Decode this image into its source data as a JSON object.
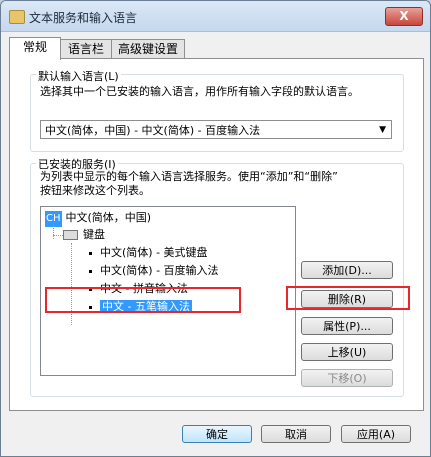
{
  "window": {
    "title": "文本服务和输入语言",
    "close_label": "X"
  },
  "tabs": [
    {
      "label": "常规"
    },
    {
      "label": "语言栏"
    },
    {
      "label": "高级键设置"
    }
  ],
  "default_language": {
    "group_title": "默认输入语言(L)",
    "description": "选择其中一个已安装的输入语言，用作所有输入字段的默认语言。",
    "selected_value": "中文(简体，中国) - 中文(简体) - 百度输入法"
  },
  "installed_services": {
    "group_title": "已安装的服务(I)",
    "description_line1": "为列表中显示的每个输入语言选择服务。使用“添加”和“删除”",
    "description_line2": "按钮来修改这个列表。",
    "tree": {
      "language_badge": "CH",
      "language": "中文(简体，中国)",
      "category": "键盘",
      "items": [
        {
          "label": "中文(简体) - 美式键盘"
        },
        {
          "label": "中文(简体) - 百度输入法"
        },
        {
          "label": "中文 - 拼音输入法"
        },
        {
          "label": "中文 - 五笔输入法"
        }
      ]
    },
    "buttons": {
      "add": "添加(D)...",
      "remove": "删除(R)",
      "properties": "属性(P)...",
      "move_up": "上移(U)",
      "move_down": "下移(O)"
    }
  },
  "footer": {
    "ok": "确定",
    "cancel": "取消",
    "apply": "应用(A)"
  }
}
